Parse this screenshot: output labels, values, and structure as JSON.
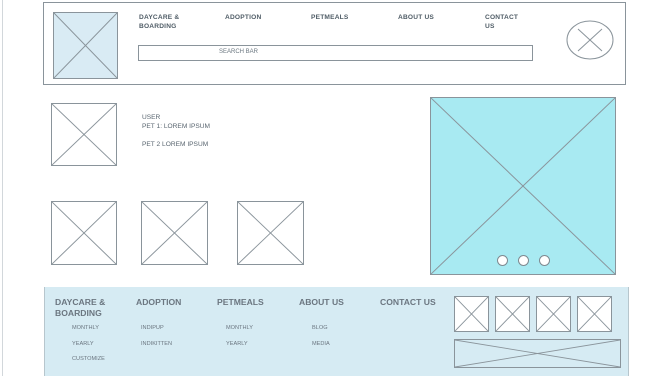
{
  "header": {
    "nav": [
      {
        "label_line1": "DAYCARE &",
        "label_line2": "BOARDING"
      },
      {
        "label_line1": "ADOPTION",
        "label_line2": ""
      },
      {
        "label_line1": "PETMEALS",
        "label_line2": ""
      },
      {
        "label_line1": "ABOUT US",
        "label_line2": ""
      },
      {
        "label_line1": "CONTACT",
        "label_line2": "US"
      }
    ],
    "search": {
      "label": "SEARCH BAR"
    }
  },
  "user": {
    "title": "USER",
    "pet1": "PET 1: LOREM IPSUM",
    "pet2": "PET 2 LOREM IPSUM"
  },
  "colors": {
    "hero": "#a8eaf2",
    "footer_bg": "#d6ebf3",
    "logo_fill": "#d9ebf4"
  },
  "footer": {
    "columns": [
      {
        "title_line1": "DAYCARE &",
        "title_line2": "BOARDING",
        "links": [
          "MONTHLY",
          "YEARLY",
          "CUSTOMIZE"
        ]
      },
      {
        "title_line1": "ADOPTION",
        "title_line2": "",
        "links": [
          "INDIPUP",
          "INDIKITTEN"
        ]
      },
      {
        "title_line1": "PETMEALS",
        "title_line2": "",
        "links": [
          "MONTHLY",
          "YEARLY"
        ]
      },
      {
        "title_line1": "ABOUT US",
        "title_line2": "",
        "links": [
          "BLOG",
          "MEDIA"
        ]
      },
      {
        "title_line1": "CONTACT US",
        "title_line2": "",
        "links": []
      }
    ]
  }
}
